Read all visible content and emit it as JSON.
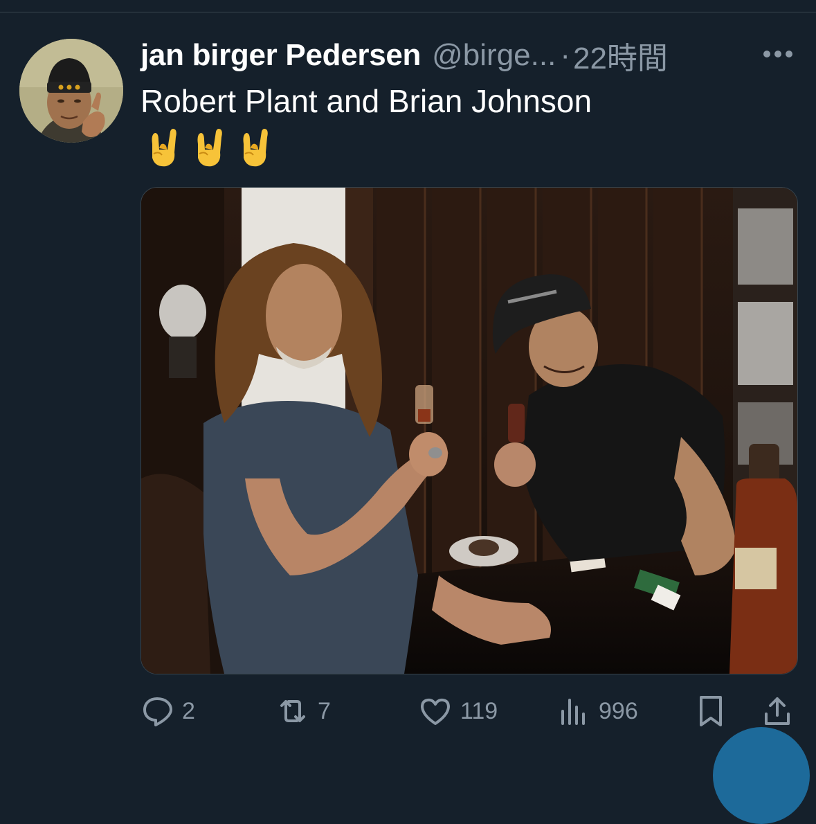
{
  "tweet": {
    "author_name": "jan birger Pedersen",
    "handle": "@birge...",
    "separator": "·",
    "time": "22時間",
    "text": "Robert Plant and Brian Johnson",
    "emojis": [
      "rock-on-hand",
      "rock-on-hand",
      "rock-on-hand"
    ],
    "media": {
      "kind": "photo"
    }
  },
  "actions": {
    "replies": "2",
    "retweets": "7",
    "likes": "119",
    "views": "996"
  },
  "colors": {
    "background": "#15202b",
    "primary_text": "#ffffff",
    "secondary_text": "#8b98a5",
    "border": "#38444d"
  }
}
